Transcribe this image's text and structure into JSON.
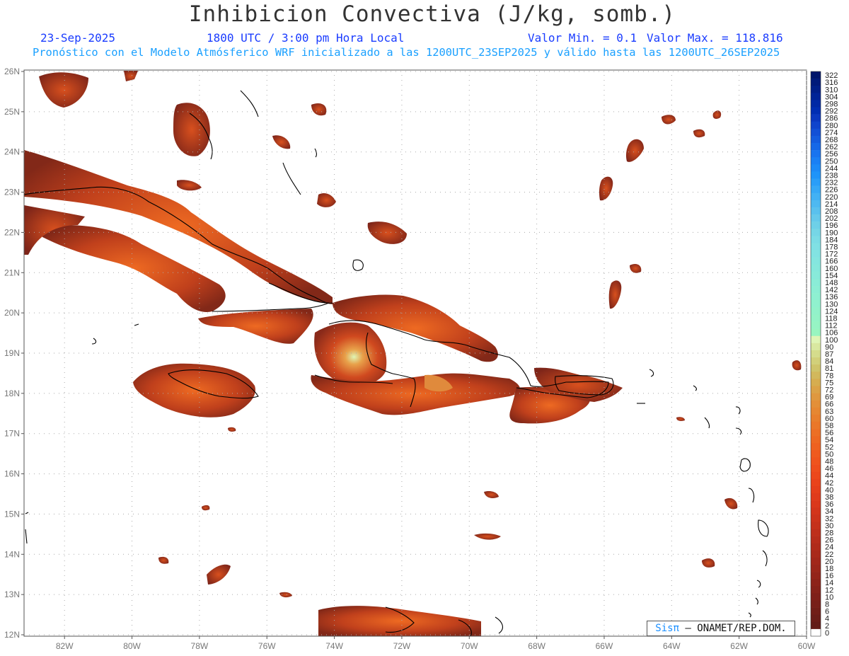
{
  "title": "Inhibicion Convectiva (J/kg, somb.)",
  "header": {
    "date": "23-Sep-2025",
    "time": "1800 UTC / 3:00 pm Hora Local",
    "valmin": "Valor Min. = 0.1",
    "valmax": "Valor Max. = 118.816",
    "forecast": "Pronóstico con el Modelo Atmósferico WRF inicializado a las 1200UTC_23SEP2025 y válido hasta las  1200UTC_26SEP2025"
  },
  "credit": {
    "logo": "Sisπ",
    "text": "– ONAMET/REP.DOM."
  },
  "map": {
    "lat_labels": [
      "26N",
      "25N",
      "24N",
      "23N",
      "22N",
      "21N",
      "20N",
      "19N",
      "18N",
      "17N",
      "16N",
      "15N",
      "14N",
      "13N",
      "12N"
    ],
    "lon_labels": [
      "82W",
      "80W",
      "78W",
      "76W",
      "74W",
      "72W",
      "70W",
      "68W",
      "66W",
      "64W",
      "62W",
      "60W"
    ],
    "lat_range": [
      12,
      26
    ],
    "lon_range": [
      -83.2,
      -60
    ],
    "grid": true
  },
  "legend": {
    "labels": [
      "322",
      "316",
      "310",
      "304",
      "298",
      "292",
      "286",
      "280",
      "274",
      "268",
      "262",
      "256",
      "250",
      "244",
      "238",
      "232",
      "226",
      "220",
      "214",
      "208",
      "202",
      "196",
      "190",
      "184",
      "178",
      "172",
      "166",
      "160",
      "154",
      "148",
      "142",
      "136",
      "130",
      "124",
      "118",
      "112",
      "106",
      "100",
      "90",
      "87",
      "84",
      "81",
      "78",
      "75",
      "72",
      "69",
      "66",
      "63",
      "60",
      "58",
      "56",
      "54",
      "52",
      "50",
      "48",
      "46",
      "44",
      "42",
      "40",
      "38",
      "36",
      "34",
      "32",
      "30",
      "28",
      "26",
      "24",
      "22",
      "20",
      "18",
      "16",
      "14",
      "12",
      "10",
      "8",
      "6",
      "4",
      "2",
      "0"
    ],
    "colors": [
      "#00156b",
      "#001a7a",
      "#001f88",
      "#002497",
      "#0029a5",
      "#002eb3",
      "#0a38c0",
      "#0f44cc",
      "#1250d6",
      "#145cdf",
      "#1668e8",
      "#1874ef",
      "#1a80f4",
      "#1c8af7",
      "#1e94f9",
      "#2a9ef8",
      "#36a8f6",
      "#42b1f4",
      "#4eb9f1",
      "#5ac1ee",
      "#66c9eb",
      "#6ed0e8",
      "#76d6e6",
      "#7cdce5",
      "#80e0e4",
      "#82e3e2",
      "#84e6df",
      "#86e8dc",
      "#88eada",
      "#8aecd7",
      "#8ceed4",
      "#8ef0d1",
      "#90f1ce",
      "#92f2ca",
      "#94f3c7",
      "#96f4c4",
      "#98f5c0",
      "#dff5b5",
      "#d9e8a0",
      "#d5dc8c",
      "#d2d07a",
      "#cfc46a",
      "#d2b85c",
      "#d6ad50",
      "#dba247",
      "#df983f",
      "#e38f38",
      "#e68732",
      "#e87f2d",
      "#ea7729",
      "#ec6f25",
      "#ed6822",
      "#ee6120",
      "#ef5a1e",
      "#ef541d",
      "#ee4e1c",
      "#ec481b",
      "#e9431b",
      "#e53f1b",
      "#e03b1b",
      "#da381b",
      "#d3351b",
      "#cc331b",
      "#c5311b",
      "#be2f1b",
      "#b72d1b",
      "#b02b1a",
      "#a9291a",
      "#a2271a",
      "#9b261a",
      "#94241a",
      "#8d2319",
      "#862219",
      "#7f2019",
      "#781f19",
      "#711e18",
      "#6a1d18",
      "#631c18",
      "#ffffff"
    ]
  }
}
